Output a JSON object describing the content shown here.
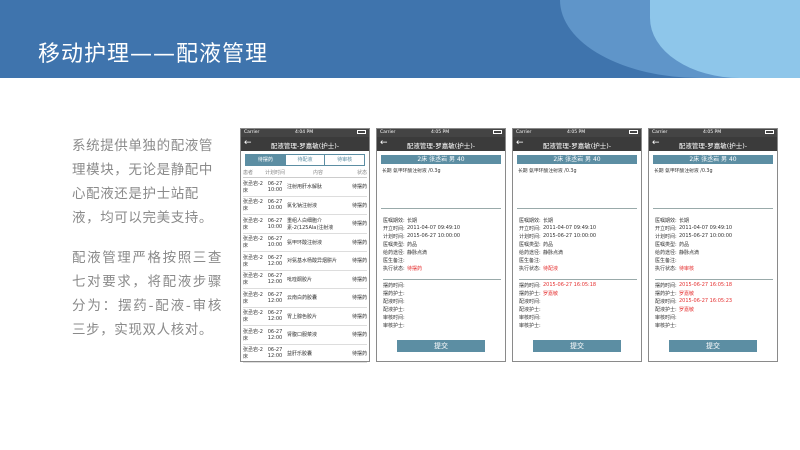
{
  "header": {
    "title": "移动护理——配液管理"
  },
  "description": {
    "p1": "系统提供单独的配液管理模块，无论是静配中心配液还是护士站配液，均可以完美支持。",
    "p2": "配液管理严格按照三查七对要求，将配液步骤分为：摆药-配液-审核三步，实现双人核对。"
  },
  "phone1": {
    "status": {
      "carrier": "Carrier",
      "time": "4:04 PM"
    },
    "nav_title": "配液管理-罗嘉敏(护士)-",
    "tabs": [
      "待摆药",
      "待配液",
      "待审核"
    ],
    "columns": [
      "患者",
      "计划时间",
      "内容",
      "状态"
    ],
    "rows": [
      {
        "patient": "张丞岩-2床",
        "time": "06-27 10:00",
        "content": "注射用肝水解肽",
        "status": "待摆药"
      },
      {
        "patient": "张丞岩-2床",
        "time": "06-27 10:00",
        "content": "氯化钠注射液",
        "status": "待摆药"
      },
      {
        "patient": "张丞岩-2床",
        "time": "06-27 10:00",
        "content": "重组人白细胞介素-2(125Ala)注射液",
        "status": "待摆药"
      },
      {
        "patient": "张丞岩-2床",
        "time": "06-27 10:00",
        "content": "氨甲环酸注射液",
        "status": "待摆药"
      },
      {
        "patient": "张丞岩-2床",
        "time": "06-27 12:00",
        "content": "对氨基水杨酸异烟肼片",
        "status": "待摆药"
      },
      {
        "patient": "张丞岩-2床",
        "time": "06-27 12:00",
        "content": "吡喹酮胶片",
        "status": "待摆药"
      },
      {
        "patient": "张丞岩-2床",
        "time": "06-27 12:00",
        "content": "云南白药胶囊",
        "status": "待摆药"
      },
      {
        "patient": "张丞岩-2床",
        "time": "06-27 12:00",
        "content": "胃上腺色胶片",
        "status": "待摆药"
      },
      {
        "patient": "张丞岩-2床",
        "time": "06-27 12:00",
        "content": "肾腹口服菜液",
        "status": "待摆药"
      },
      {
        "patient": "张丞岩-2床",
        "time": "06-27 12:00",
        "content": "益肝乐胶囊",
        "status": "待摆药"
      }
    ]
  },
  "detail_common": {
    "nav_title": "配液管理-罗嘉敏(护士)-",
    "patient_bar": "2床  张丞岩  男  40",
    "drug": "氨甲环酸注射液 /0.3g",
    "drug_prefix": "长期",
    "submit": "提交",
    "labels": [
      "医嘱期效:",
      "开立时间:",
      "计划时间:",
      "医嘱类型:",
      "给药途径:",
      "医生备注:",
      "执行状态:",
      "摆药时间:",
      "摆药护士:",
      "配液时间:",
      "配液护士:",
      "审核时间:",
      "审核护士:"
    ],
    "values": [
      "长期",
      "2011-04-07 09:49:10",
      "2015-06-27 10:00:00",
      "药品",
      "静脉点滴",
      ""
    ]
  },
  "phone2": {
    "status_time": "4:05 PM",
    "exec_status": "待摆药",
    "dispense_time": "",
    "dispense_nurse": "",
    "mix_time": "",
    "mix_nurse": ""
  },
  "phone3": {
    "status_time": "4:05 PM",
    "exec_status": "待配液",
    "dispense_time": "2015-06-27 16:05:18",
    "dispense_nurse": "罗嘉敏",
    "mix_time": "",
    "mix_nurse": ""
  },
  "phone4": {
    "status_time": "4:05 PM",
    "exec_status": "待审核",
    "dispense_time": "2015-06-27 16:05:18",
    "dispense_nurse": "罗嘉敏",
    "mix_time": "2015-06-27 16:05:23",
    "mix_nurse": "罗嘉敏"
  },
  "colors": {
    "header": "#3f74ad",
    "accent": "#5c8ea3",
    "highlight": "#e53030"
  }
}
